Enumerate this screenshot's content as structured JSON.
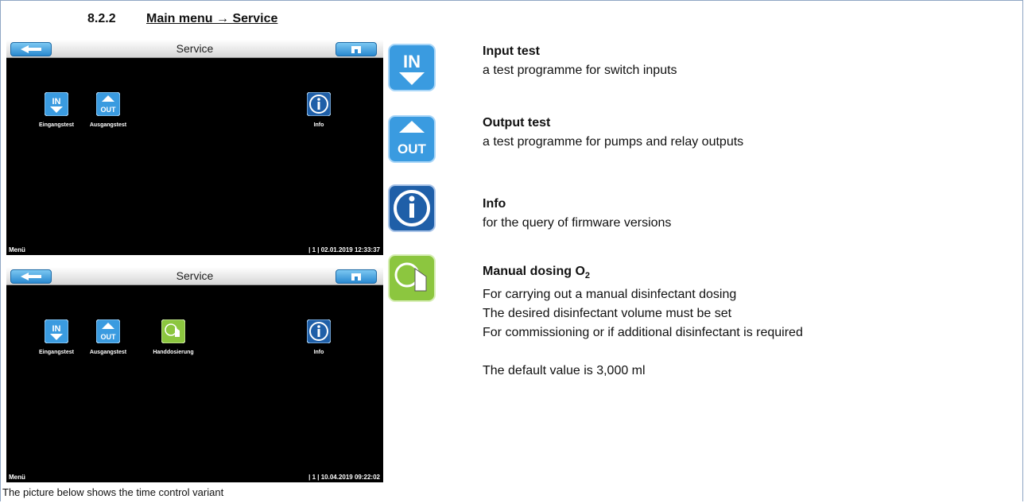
{
  "heading": {
    "number": "8.2.2",
    "title": "Main menu → Service"
  },
  "screens": [
    {
      "title": "Service",
      "tiles": [
        {
          "label": "Eingangstest",
          "icon": "input-test-icon"
        },
        {
          "label": "Ausgangstest",
          "icon": "output-test-icon"
        },
        {
          "label": "Info",
          "icon": "info-icon"
        }
      ],
      "footer_left": "Menü",
      "footer_right": "| 1 | 02.01.2019 12:33:37"
    },
    {
      "title": "Service",
      "tiles": [
        {
          "label": "Eingangstest",
          "icon": "input-test-icon"
        },
        {
          "label": "Ausgangstest",
          "icon": "output-test-icon"
        },
        {
          "label": "Handdosierung",
          "icon": "manual-dosing-icon"
        },
        {
          "label": "Info",
          "icon": "info-icon"
        }
      ],
      "footer_left": "Menü",
      "footer_right": "| 1 | 10.04.2019 09:22:02"
    }
  ],
  "descriptions": {
    "input": {
      "title": "Input test",
      "lines": [
        "a test programme for switch inputs"
      ]
    },
    "output": {
      "title": "Output test",
      "lines": [
        "a test programme for pumps and relay outputs"
      ]
    },
    "info": {
      "title": "Info",
      "lines": [
        "for the query of firmware versions"
      ]
    },
    "manual": {
      "title": "Manual dosing O",
      "title_sub": "2",
      "lines": [
        "For carrying out a manual disinfectant dosing",
        "The desired disinfectant volume must be set",
        "For commissioning or if additional disinfectant is required"
      ],
      "note": "The default value is 3,000 ml"
    }
  },
  "icon_labels": {
    "in": "IN",
    "out": "OUT"
  },
  "caption": "The picture below shows the time control variant",
  "colors": {
    "screen_bg": "#000000",
    "accent_blue": "#2a89d0",
    "accent_green": "#8cc63f"
  }
}
